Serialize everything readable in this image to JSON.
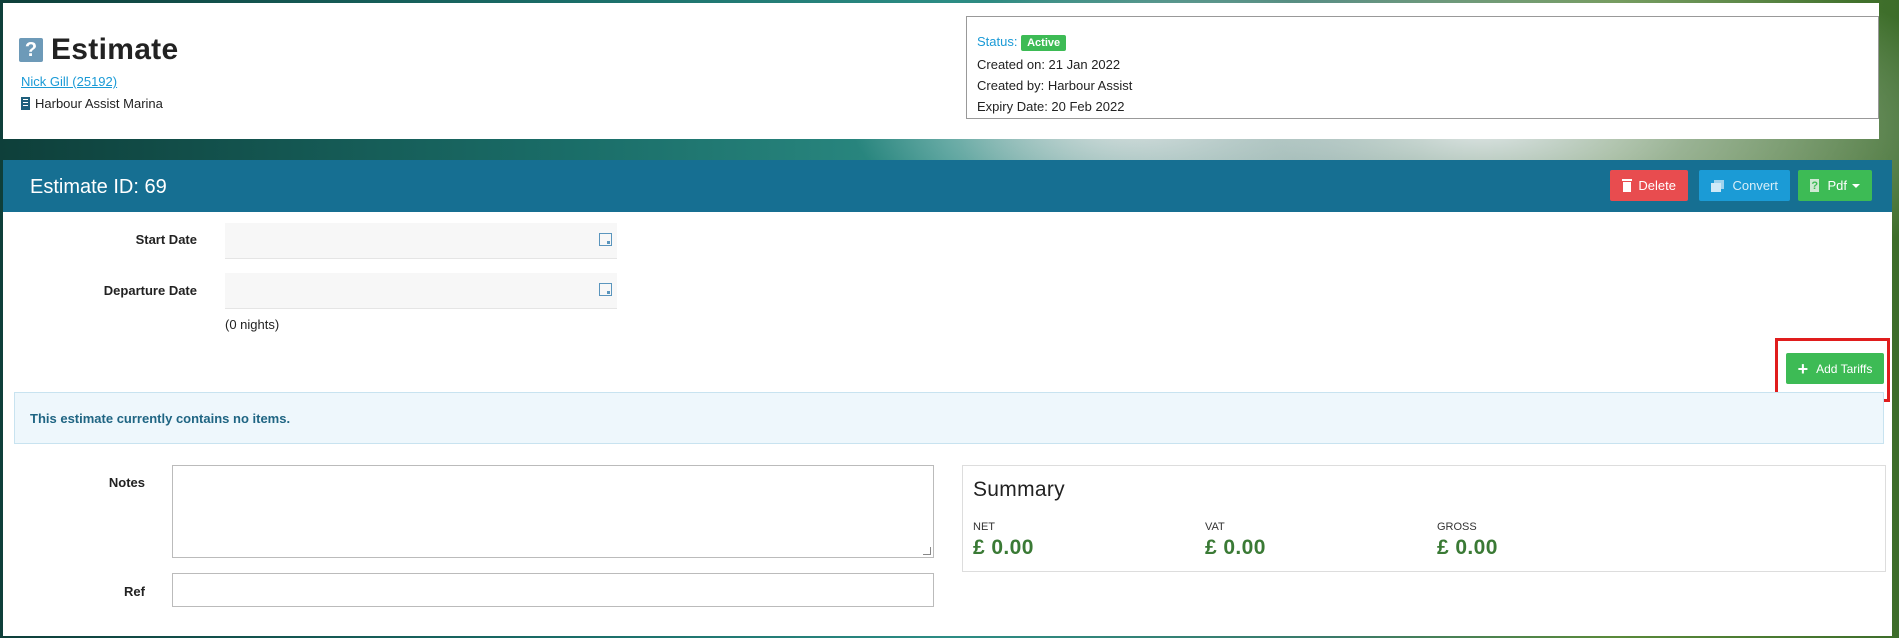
{
  "header": {
    "title": "Estimate",
    "customer_link": "Nick Gill (25192)",
    "marina": "Harbour Assist Marina"
  },
  "status": {
    "status_label": "Status:",
    "status_value": "Active",
    "created_on": "Created on: 21 Jan 2022",
    "created_by": "Created by: Harbour Assist",
    "expiry_date": "Expiry Date: 20 Feb 2022"
  },
  "estimate": {
    "id_label": "Estimate ID: 69",
    "actions": {
      "delete": "Delete",
      "convert": "Convert",
      "pdf": "Pdf"
    }
  },
  "form": {
    "start_date_label": "Start Date",
    "start_date_value": "",
    "departure_date_label": "Departure Date",
    "departure_date_value": "",
    "nights": "(0 nights)",
    "add_tariffs": "Add Tariffs",
    "empty_message": "This estimate currently contains no items.",
    "notes_label": "Notes",
    "notes_value": "",
    "ref_label": "Ref",
    "ref_value": ""
  },
  "summary": {
    "title": "Summary",
    "net_label": "NET",
    "net_value": "£ 0.00",
    "vat_label": "VAT",
    "vat_value": "£ 0.00",
    "gross_label": "GROSS",
    "gross_value": "£ 0.00"
  },
  "colors": {
    "header_bar": "#166f92",
    "delete": "#e84c4f",
    "convert": "#1b9bd6",
    "success": "#3dbb55",
    "highlight": "#e01d1d"
  }
}
